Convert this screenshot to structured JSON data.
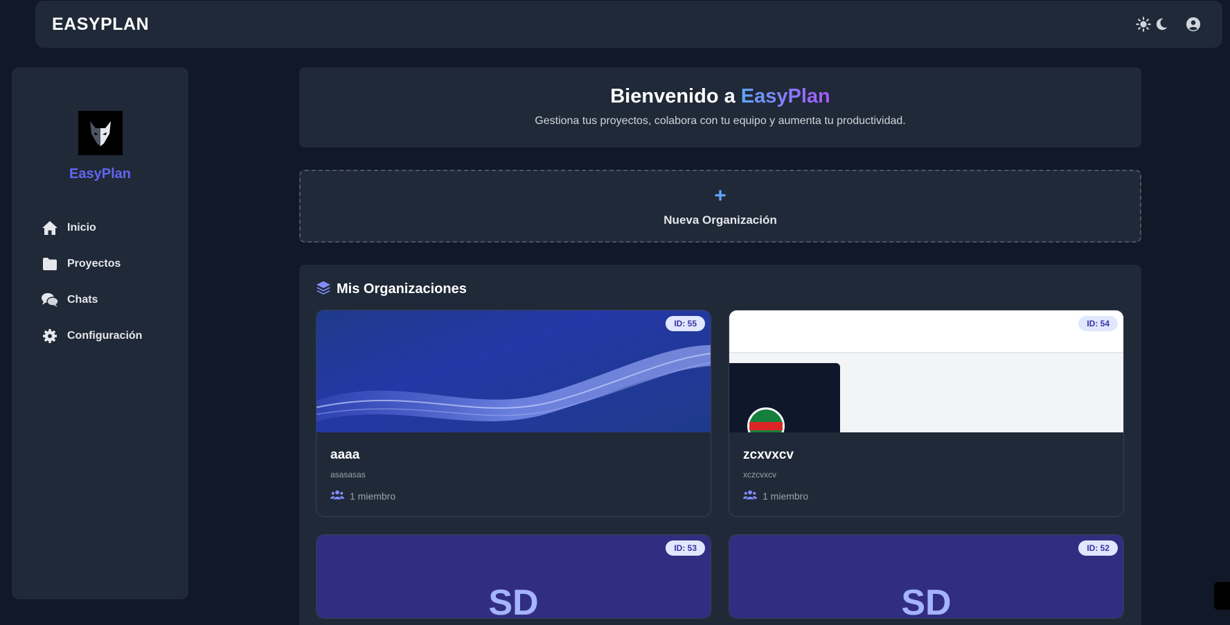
{
  "header": {
    "brand": "EASYPLAN",
    "icons": [
      "sun-icon",
      "moon-icon",
      "user-circle-icon"
    ]
  },
  "sidebar": {
    "brand": "EasyPlan",
    "items": [
      {
        "label": "Inicio",
        "icon": "home-icon"
      },
      {
        "label": "Proyectos",
        "icon": "folder-icon"
      },
      {
        "label": "Chats",
        "icon": "comments-icon"
      },
      {
        "label": "Configuración",
        "icon": "gear-icon"
      }
    ]
  },
  "welcome": {
    "title_prefix": "Bienvenido a ",
    "title_accent": "EasyPlan",
    "subtitle": "Gestiona tus proyectos, colabora con tu equipo y aumenta tu productividad."
  },
  "new_org": {
    "plus": "+",
    "label": "Nueva Organización"
  },
  "orgs": {
    "title": "Mis Organizaciones",
    "cards": [
      {
        "id_label": "ID: 55",
        "name": "aaaa",
        "description": "asasasas",
        "members": "1 miembro"
      },
      {
        "id_label": "ID: 54",
        "name": "zcxvxcv",
        "description": "xczcvxcv",
        "members": "1 miembro"
      },
      {
        "id_label": "ID: 53",
        "initials": "SD"
      },
      {
        "id_label": "ID: 52",
        "initials": "SD"
      }
    ]
  },
  "colors": {
    "accent": "#6366f1",
    "background": "#111827",
    "panel": "#1f2937",
    "badge_bg": "#e0e7ff"
  }
}
